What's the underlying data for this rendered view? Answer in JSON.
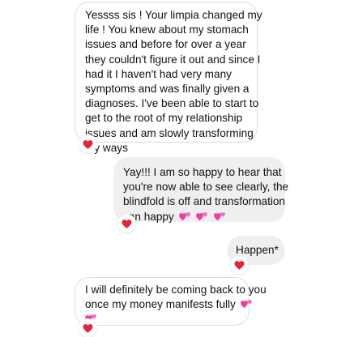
{
  "messages": [
    {
      "direction": "incoming",
      "lines": [
        "Yessss sis ! Your limpia changed my",
        "life ! You knew about my stomach",
        "issues and before for over a year",
        "they couldn't figure it out and since I",
        "had it I haven't had very many",
        "symptoms and was finally given a",
        "diagnoses. I've been able to start to",
        "get to the root of my relationship",
        "issues and am slowly transforming",
        "my ways"
      ],
      "reaction": "red-heart"
    },
    {
      "direction": "outgoing",
      "lines": [
        "Yay!!! I am so happy to hear that",
        "you're now able to see clearly, the",
        "blindfold is off and transformation",
        "can happy"
      ],
      "trailing_emojis": [
        "two-hearts",
        "two-hearts",
        "two-hearts"
      ],
      "reaction": "red-heart"
    },
    {
      "direction": "outgoing",
      "lines": [
        "Happen*"
      ],
      "reaction": "red-heart"
    },
    {
      "direction": "incoming",
      "lines": [
        "I will definitely be coming back to you",
        "once my money manifests fully"
      ],
      "trailing_emojis": [
        "two-hearts",
        "two-hearts"
      ],
      "reaction": "red-heart"
    }
  ],
  "colors": {
    "incoming_bubble": "#ffffff",
    "incoming_border": "#dcdcdc",
    "outgoing_bubble": "#efefef",
    "text": "#111111",
    "reaction_heart": "#e0263a",
    "emoji_pink": "#ee3fa0"
  }
}
